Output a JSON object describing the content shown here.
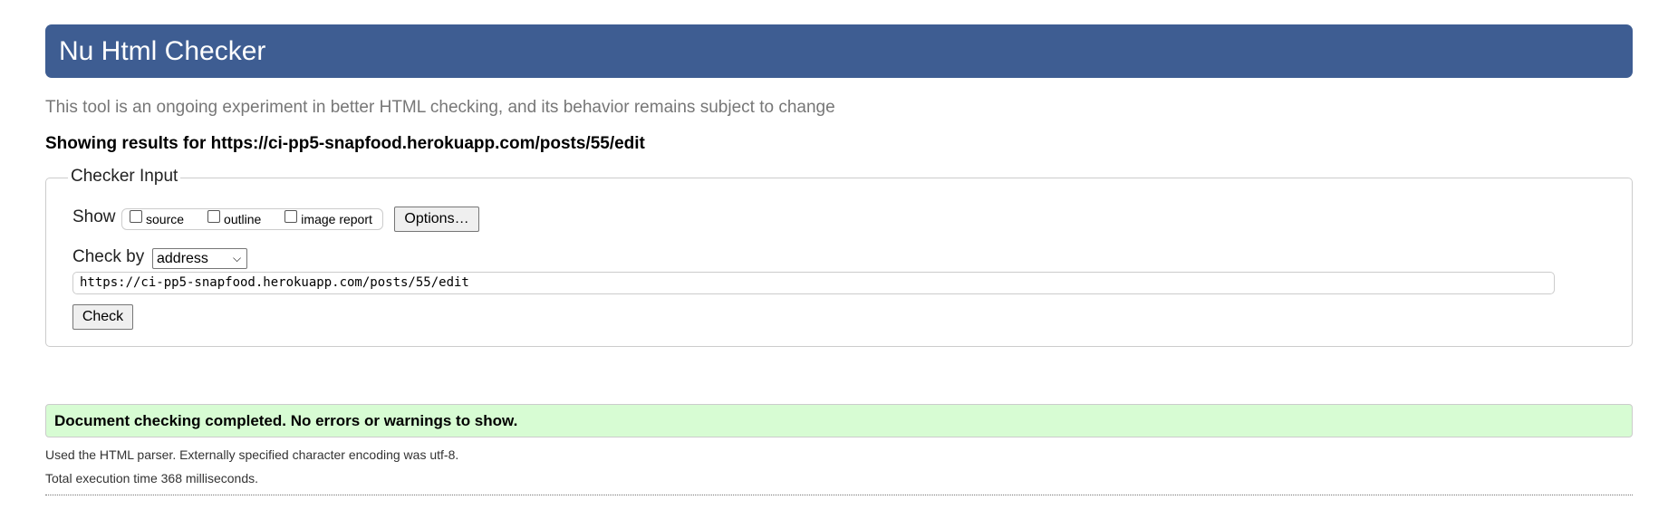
{
  "header": {
    "title": "Nu Html Checker"
  },
  "subtitle": "This tool is an ongoing experiment in better HTML checking, and its behavior remains subject to change",
  "results_heading": "Showing results for https://ci-pp5-snapfood.herokuapp.com/posts/55/edit",
  "checker_input": {
    "legend": "Checker Input",
    "show_label": "Show",
    "show_options": [
      {
        "label": "source",
        "checked": false
      },
      {
        "label": "outline",
        "checked": false
      },
      {
        "label": "image report",
        "checked": false
      }
    ],
    "options_button": "Options…",
    "check_by_label": "Check by",
    "check_by_value": "address",
    "url_value": "https://ci-pp5-snapfood.herokuapp.com/posts/55/edit",
    "check_button": "Check"
  },
  "result": {
    "message": "Document checking completed. No errors or warnings to show.",
    "parser_info": "Used the HTML parser. Externally specified character encoding was utf-8.",
    "execution_time": "Total execution time 368 milliseconds."
  }
}
